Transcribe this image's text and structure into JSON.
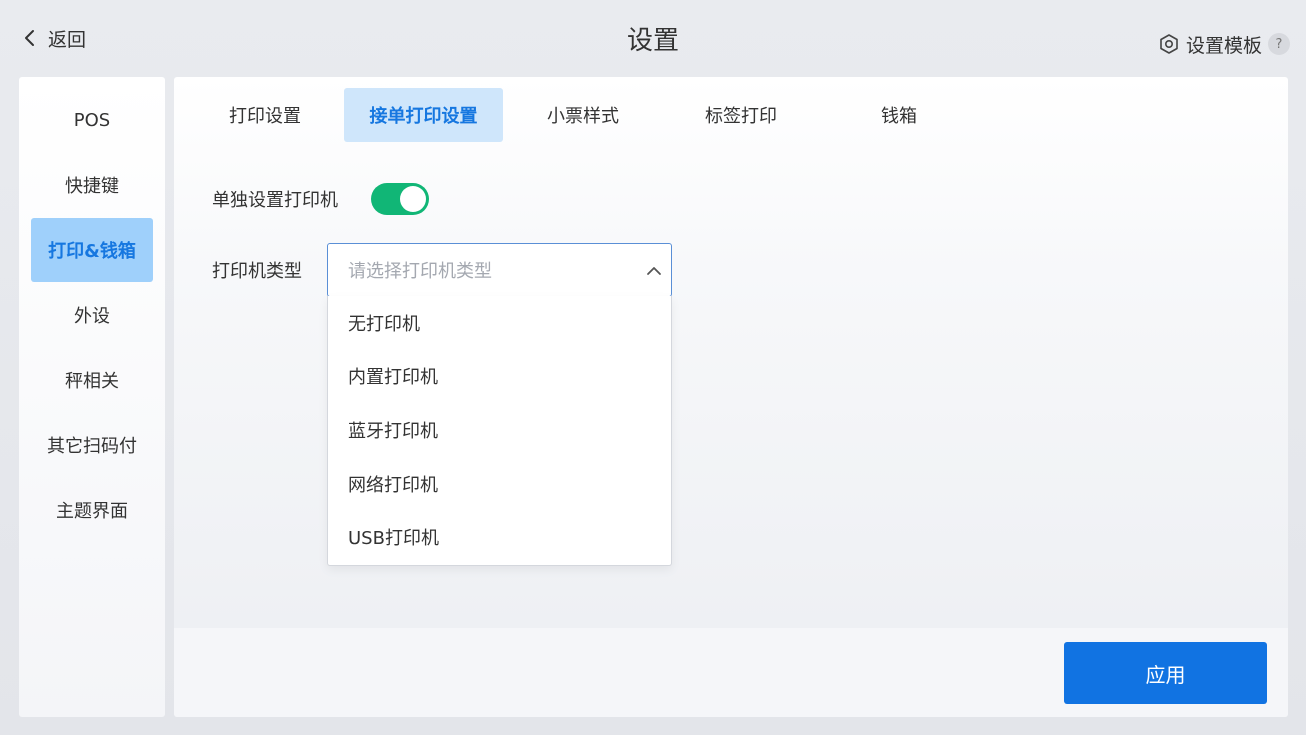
{
  "header": {
    "back_label": "返回",
    "title": "设置",
    "template_label": "设置模板",
    "help_symbol": "?"
  },
  "sidebar": {
    "items": [
      {
        "label": "POS",
        "active": false
      },
      {
        "label": "快捷键",
        "active": false
      },
      {
        "label": "打印&钱箱",
        "active": true
      },
      {
        "label": "外设",
        "active": false
      },
      {
        "label": "秤相关",
        "active": false
      },
      {
        "label": "其它扫码付",
        "active": false
      },
      {
        "label": "主题界面",
        "active": false
      }
    ]
  },
  "tabs": [
    {
      "label": "打印设置",
      "active": false
    },
    {
      "label": "接单打印设置",
      "active": true
    },
    {
      "label": "小票样式",
      "active": false
    },
    {
      "label": "标签打印",
      "active": false
    },
    {
      "label": "钱箱",
      "active": false
    }
  ],
  "form": {
    "separate_printer_label": "单独设置打印机",
    "separate_printer_on": true,
    "printer_type_label": "打印机类型",
    "printer_type_placeholder": "请选择打印机类型",
    "printer_type_options": [
      "无打印机",
      "内置打印机",
      "蓝牙打印机",
      "网络打印机",
      "USB打印机"
    ]
  },
  "footer": {
    "apply_label": "应用"
  },
  "colors": {
    "accent": "#1173e2",
    "toggle_on": "#11b676",
    "active_side": "#9fd0fb",
    "active_tab": "#cfe6fb"
  },
  "icons": {
    "back": "chevron-left-icon",
    "template": "hexagon-gear-icon",
    "select_arrow": "chevron-up-icon"
  }
}
